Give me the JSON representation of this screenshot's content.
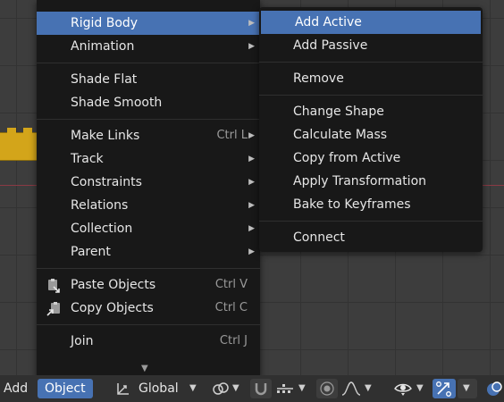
{
  "main_menu": {
    "items": [
      {
        "label": "Rigid Body",
        "submenu": true,
        "active": true
      },
      {
        "label": "Animation",
        "submenu": true
      },
      {
        "label": "Shade Flat"
      },
      {
        "label": "Shade Smooth"
      },
      {
        "label": "Make Links",
        "shortcut": "Ctrl L",
        "submenu": true
      },
      {
        "label": "Track",
        "submenu": true
      },
      {
        "label": "Constraints",
        "submenu": true
      },
      {
        "label": "Relations",
        "submenu": true
      },
      {
        "label": "Collection",
        "submenu": true
      },
      {
        "label": "Parent",
        "submenu": true
      },
      {
        "label": "Paste Objects",
        "shortcut": "Ctrl V",
        "icon": "paste-icon"
      },
      {
        "label": "Copy Objects",
        "shortcut": "Ctrl C",
        "icon": "copy-icon"
      },
      {
        "label": "Join",
        "shortcut": "Ctrl J"
      }
    ]
  },
  "rigid_body_menu": {
    "items": [
      {
        "label": "Add Active",
        "active": true
      },
      {
        "label": "Add Passive"
      },
      {
        "label": "Remove"
      },
      {
        "label": "Change Shape"
      },
      {
        "label": "Calculate Mass"
      },
      {
        "label": "Copy from Active"
      },
      {
        "label": "Apply Transformation"
      },
      {
        "label": "Bake to Keyframes"
      },
      {
        "label": "Connect"
      }
    ]
  },
  "header": {
    "add_label": "Add",
    "object_label": "Object",
    "orientation": "Global"
  },
  "colors": {
    "accent": "#4772b3",
    "menu_bg": "#181818",
    "viewport_bg": "#3d3d3d"
  }
}
